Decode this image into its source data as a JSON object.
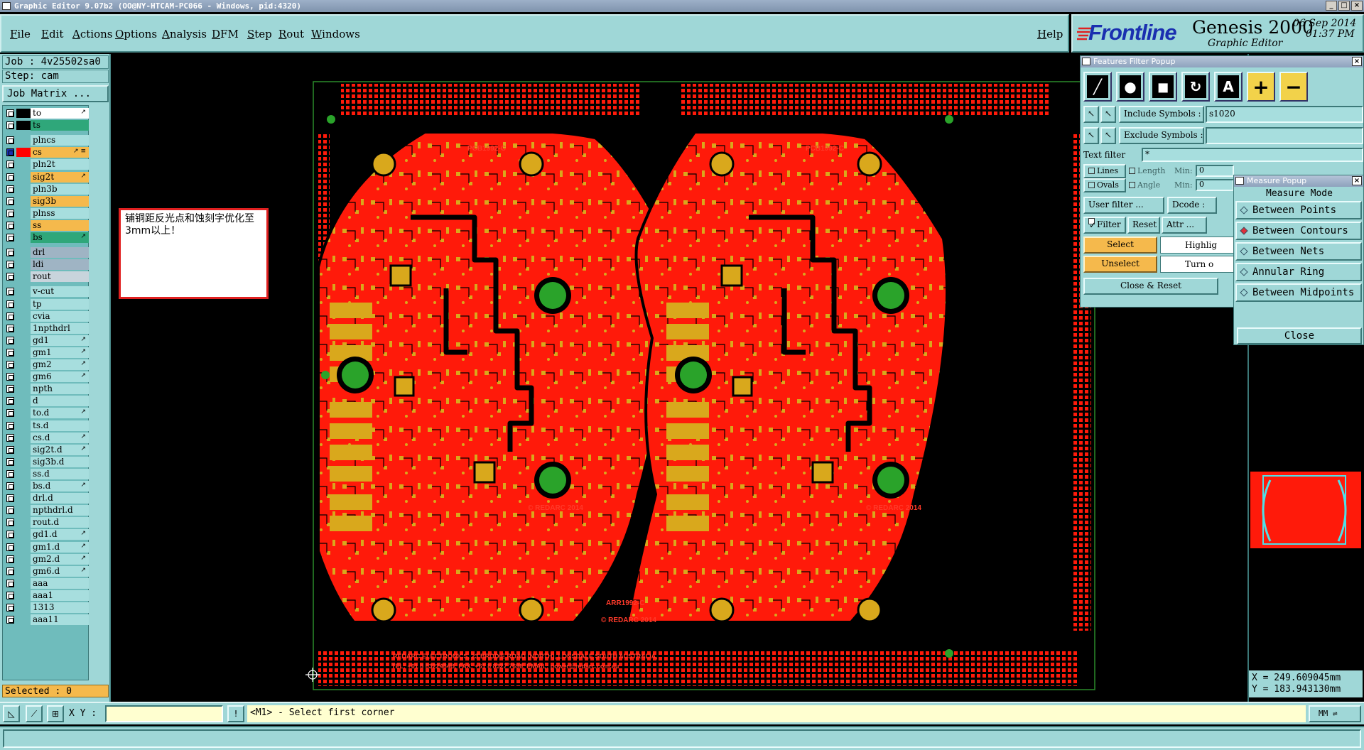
{
  "window": {
    "title": "Graphic Editor 9.07b2 (OO@NY-HTCAM-PC066 - Windows, pid:4320)"
  },
  "menu": {
    "items": [
      "File",
      "Edit",
      "Actions",
      "Options",
      "Analysis",
      "DFM",
      "Step",
      "Rout",
      "Windows"
    ],
    "help": "Help"
  },
  "brand": {
    "logo": "Frontline",
    "product": "Genesis 2000",
    "subtitle": "Graphic Editor",
    "date": "06 Sep 2014",
    "time": "01:37 PM"
  },
  "job": {
    "job_label": "Job : 4v25502sa0",
    "step_label": "Step: cam",
    "matrix_button": "Job Matrix ..."
  },
  "layers": [
    {
      "name": "to",
      "swatch": "#000000",
      "color": "#ffffff",
      "mark": "↗"
    },
    {
      "name": "ts",
      "swatch": "#000000",
      "color": "#2fa77a",
      "mark": ""
    },
    {
      "name": "plncs",
      "swatch": "",
      "color": "#a7dede",
      "mark": ""
    },
    {
      "name": "cs",
      "swatch": "#ff0000",
      "color": "#f5b94c",
      "mark": "↗ ≡",
      "active": true
    },
    {
      "name": "pln2t",
      "swatch": "",
      "color": "#a7dede",
      "mark": ""
    },
    {
      "name": "sig2t",
      "swatch": "",
      "color": "#f5b94c",
      "mark": "↗"
    },
    {
      "name": "pln3b",
      "swatch": "",
      "color": "#a7dede",
      "mark": ""
    },
    {
      "name": "sig3b",
      "swatch": "",
      "color": "#f5b94c",
      "mark": ""
    },
    {
      "name": "plnss",
      "swatch": "",
      "color": "#a7dede",
      "mark": ""
    },
    {
      "name": "ss",
      "swatch": "",
      "color": "#f5b94c",
      "mark": ""
    },
    {
      "name": "bs",
      "swatch": "",
      "color": "#2fa77a",
      "mark": "↗"
    },
    {
      "name": "drl",
      "swatch": "",
      "color": "#9fb4c4",
      "mark": ""
    },
    {
      "name": "ldi",
      "swatch": "",
      "color": "#9fb4c4",
      "mark": ""
    },
    {
      "name": "rout",
      "swatch": "",
      "color": "#c8d4dc",
      "mark": ""
    },
    {
      "name": "v-cut",
      "swatch": "",
      "color": "#a7dede",
      "mark": ""
    },
    {
      "name": "tp",
      "swatch": "",
      "color": "#a7dede",
      "mark": ""
    },
    {
      "name": "cvia",
      "swatch": "",
      "color": "#a7dede",
      "mark": ""
    },
    {
      "name": "1npthdrl",
      "swatch": "",
      "color": "#a7dede",
      "mark": ""
    },
    {
      "name": "gd1",
      "swatch": "",
      "color": "#a7dede",
      "mark": "↗"
    },
    {
      "name": "gm1",
      "swatch": "",
      "color": "#a7dede",
      "mark": "↗"
    },
    {
      "name": "gm2",
      "swatch": "",
      "color": "#a7dede",
      "mark": "↗"
    },
    {
      "name": "gm6",
      "swatch": "",
      "color": "#a7dede",
      "mark": "↗"
    },
    {
      "name": "npth",
      "swatch": "",
      "color": "#a7dede",
      "mark": ""
    },
    {
      "name": "d",
      "swatch": "",
      "color": "#a7dede",
      "mark": ""
    },
    {
      "name": "to.d",
      "swatch": "",
      "color": "#a7dede",
      "mark": "↗"
    },
    {
      "name": "ts.d",
      "swatch": "",
      "color": "#a7dede",
      "mark": ""
    },
    {
      "name": "cs.d",
      "swatch": "",
      "color": "#a7dede",
      "mark": "↗"
    },
    {
      "name": "sig2t.d",
      "swatch": "",
      "color": "#a7dede",
      "mark": "↗"
    },
    {
      "name": "sig3b.d",
      "swatch": "",
      "color": "#a7dede",
      "mark": ""
    },
    {
      "name": "ss.d",
      "swatch": "",
      "color": "#a7dede",
      "mark": ""
    },
    {
      "name": "bs.d",
      "swatch": "",
      "color": "#a7dede",
      "mark": "↗"
    },
    {
      "name": "drl.d",
      "swatch": "",
      "color": "#a7dede",
      "mark": ""
    },
    {
      "name": "npthdrl.d",
      "swatch": "",
      "color": "#a7dede",
      "mark": ""
    },
    {
      "name": "rout.d",
      "swatch": "",
      "color": "#a7dede",
      "mark": ""
    },
    {
      "name": "gd1.d",
      "swatch": "",
      "color": "#a7dede",
      "mark": "↗"
    },
    {
      "name": "gm1.d",
      "swatch": "",
      "color": "#a7dede",
      "mark": "↗"
    },
    {
      "name": "gm2.d",
      "swatch": "",
      "color": "#a7dede",
      "mark": "↗"
    },
    {
      "name": "gm6.d",
      "swatch": "",
      "color": "#a7dede",
      "mark": "↗"
    },
    {
      "name": "aaa",
      "swatch": "",
      "color": "#a7dede",
      "mark": ""
    },
    {
      "name": "aaa1",
      "swatch": "",
      "color": "#a7dede",
      "mark": ""
    },
    {
      "name": "1313",
      "swatch": "",
      "color": "#a7dede",
      "mark": ""
    },
    {
      "name": "aaa11",
      "swatch": "",
      "color": "#a7dede",
      "mark": ""
    }
  ],
  "selected": "Selected : 0",
  "note": "铺铜距反光点和蚀刻字优化至3mm以上！",
  "board": {
    "label_left": "PCB1992-C",
    "label_right": "PCB1992-C",
    "copyright": "© REDARC 2014",
    "center_label": "ARR1992-C",
    "address": "REDARC ELECTRONICS, 23 BRODIE ROAD (NORTH), LONSDALE SOUTH AUSTRALIA,",
    "contact": "TEL: +61 8 8322484B, FAX: +61 8 8327 7698, EMAIL: power@redarc.com.au",
    "colors": {
      "copper": "#ff1a0a",
      "pad": "#d9a81c",
      "via": "#2aa32a",
      "outline": "#2a8a2a"
    }
  },
  "features_filter": {
    "title": "Features Filter Popup",
    "include_label": "Include Symbols :",
    "include_value": "s1020",
    "exclude_label": "Exclude Symbols :",
    "exclude_value": "",
    "text_filter_label": "Text filter",
    "text_filter_value": "*",
    "lines": "Lines",
    "ovals": "Ovals",
    "length": "Length",
    "angle": "Angle",
    "min": "Min:",
    "min_value": "0",
    "user_filter": "User filter ...",
    "dcode": "Dcode :",
    "filter": "Filter",
    "reset": "Reset",
    "attr": "Attr ...",
    "select": "Select",
    "highlight": "Highlig",
    "unselect": "Unselect",
    "turn_off": "Turn o",
    "close_reset": "Close & Reset"
  },
  "measure": {
    "title": "Measure Popup",
    "mode": "Measure Mode",
    "options": [
      "Between Points",
      "Between Contours",
      "Between Nets",
      "Annular Ring",
      "Between Midpoints"
    ],
    "selected_index": 1,
    "close": "Close"
  },
  "coords": {
    "x": "X = 249.609045mm",
    "y": "Y = 183.943130mm"
  },
  "bottom": {
    "xy_label": "X Y :",
    "prompt": "<M1> - Select first corner",
    "units": "MM"
  }
}
